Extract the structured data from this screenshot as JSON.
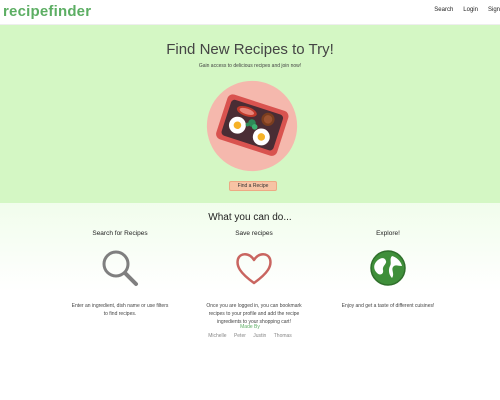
{
  "brand": {
    "name": "recipefinder",
    "color": "#5cae63"
  },
  "nav": {
    "items": [
      "Search",
      "Login",
      "Sign"
    ]
  },
  "hero": {
    "title": "Find New Recipes to Try!",
    "subtitle": "Gain access to delicious recipes and join now!",
    "cta_label": "Find a Recipe",
    "background": "#d4f7c4",
    "image_icon": "breakfast-plate-icon"
  },
  "features": {
    "title": "What you can do...",
    "items": [
      {
        "title": "Search for Recipes",
        "icon": "magnifier-icon",
        "desc_lines": [
          "Enter an ingredient, dish name or use filters",
          "to find recipes."
        ]
      },
      {
        "title": "Save recipes",
        "icon": "heart-icon",
        "desc_lines": [
          "Once you are logged in, you can bookmark",
          "recipes to your profile and add the recipe",
          "ingredients to your shopping cart!"
        ]
      },
      {
        "title": "Explore!",
        "icon": "globe-icon",
        "desc_lines": [
          "Enjoy and get a taste of different cuisines!"
        ]
      }
    ]
  },
  "footer": {
    "made_by_label": "Made By",
    "authors": [
      "Michelle",
      "Peter",
      "Justin",
      "Thomas"
    ]
  }
}
